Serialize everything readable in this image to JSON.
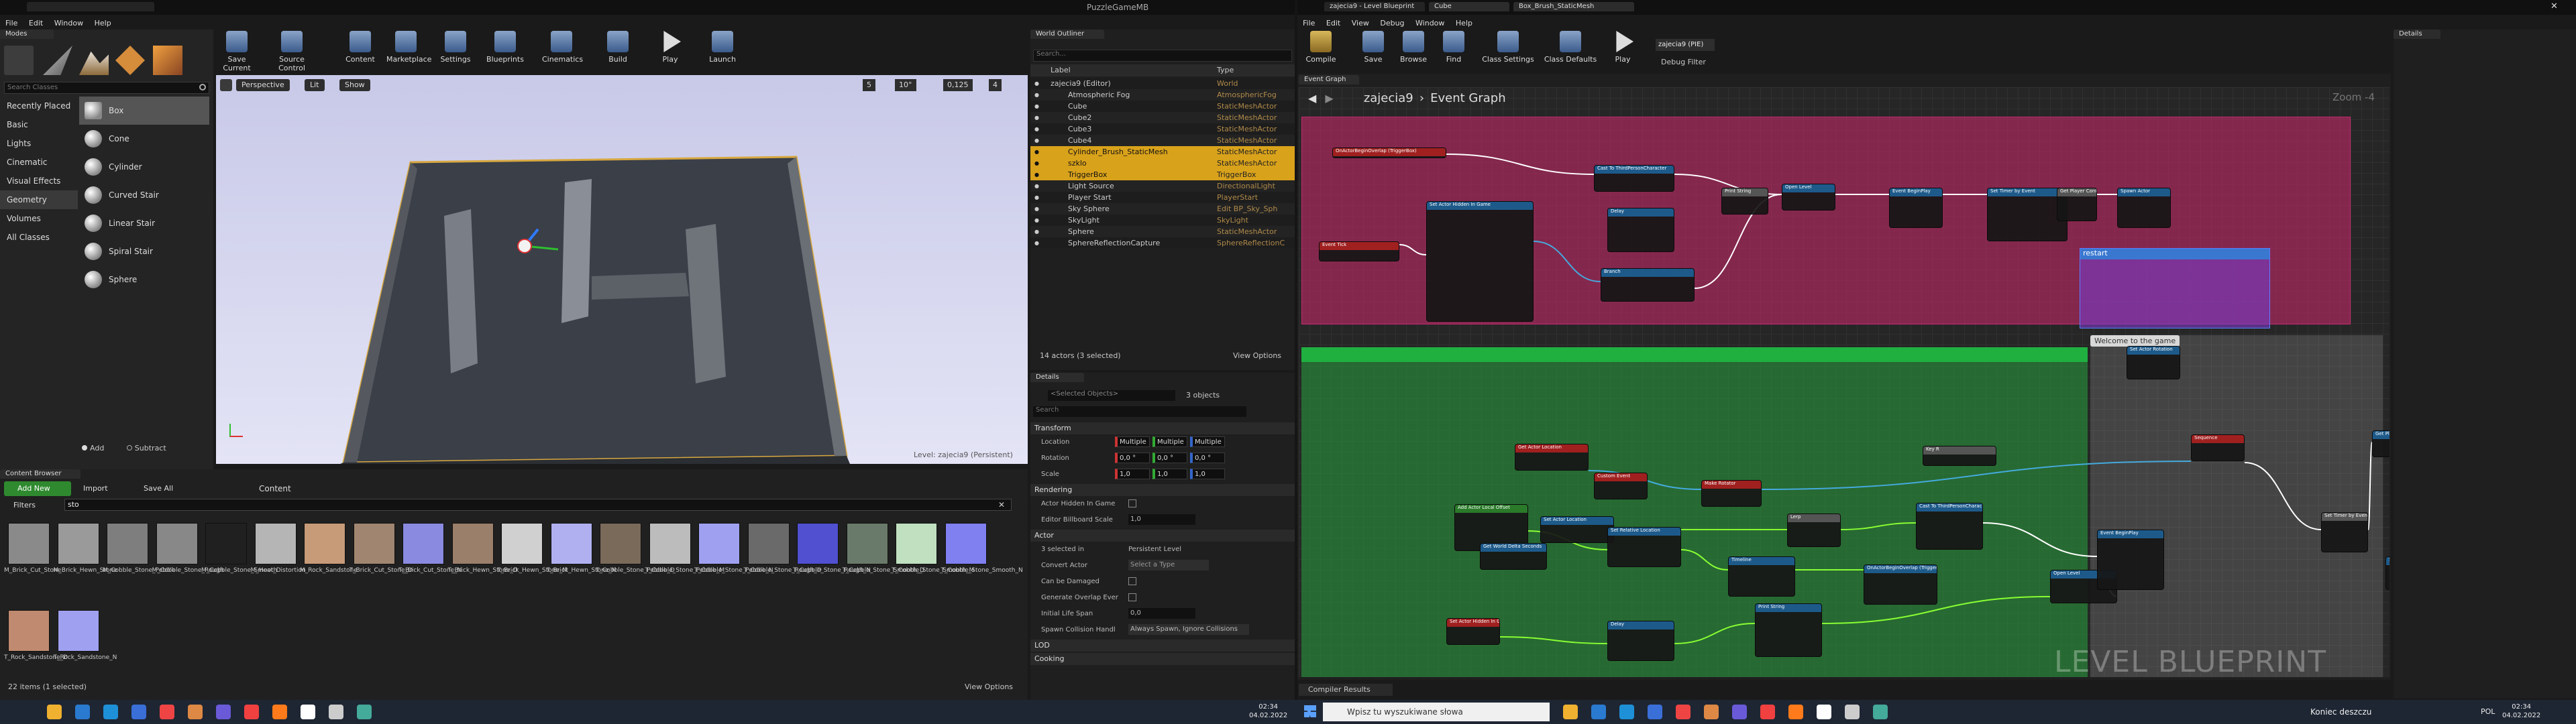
{
  "left_window": {
    "title": "PuzzleGameMB",
    "menu": [
      "File",
      "Edit",
      "Window",
      "Help"
    ],
    "modes_tab": "Modes",
    "toolbar": [
      "Save Current",
      "Source Control",
      "Content",
      "Marketplace",
      "Settings",
      "Blueprints",
      "Cinematics",
      "Build",
      "Play",
      "Launch"
    ],
    "search_classes_placeholder": "Search Classes",
    "place_categories": [
      "Recently Placed",
      "Basic",
      "Lights",
      "Cinematic",
      "Visual Effects",
      "Geometry",
      "Volumes",
      "All Classes"
    ],
    "place_items": [
      "Box",
      "Cone",
      "Cylinder",
      "Curved Stair",
      "Linear Stair",
      "Spiral Stair",
      "Sphere"
    ],
    "brush_add": "Add",
    "brush_subtract": "Subtract",
    "viewport": {
      "perspective": "Perspective",
      "lit": "Lit",
      "show": "Show",
      "grid_snap": "5",
      "rot_snap": "10°",
      "scale_snap": "0,125",
      "cam_speed": "4",
      "level_label": "Level:",
      "level_name": "zajecia9 (Persistent)"
    },
    "outliner": {
      "tab": "World Outliner",
      "search_placeholder": "Search...",
      "col_label": "Label",
      "col_type": "Type",
      "rows": [
        {
          "label": "zajecia9 (Editor)",
          "type": "World",
          "sel": false
        },
        {
          "label": "Atmospheric Fog",
          "type": "AtmosphericFog",
          "sel": false
        },
        {
          "label": "Cube",
          "type": "StaticMeshActor",
          "sel": false
        },
        {
          "label": "Cube2",
          "type": "StaticMeshActor",
          "sel": false
        },
        {
          "label": "Cube3",
          "type": "StaticMeshActor",
          "sel": false
        },
        {
          "label": "Cube4",
          "type": "StaticMeshActor",
          "sel": false
        },
        {
          "label": "Cylinder_Brush_StaticMesh",
          "type": "StaticMeshActor",
          "sel": true
        },
        {
          "label": "szklo",
          "type": "StaticMeshActor",
          "sel": true
        },
        {
          "label": "TriggerBox",
          "type": "TriggerBox",
          "sel": true
        },
        {
          "label": "Light Source",
          "type": "DirectionalLight",
          "sel": false
        },
        {
          "label": "Player Start",
          "type": "PlayerStart",
          "sel": false
        },
        {
          "label": "Sky Sphere",
          "type": "Edit BP_Sky_Sph",
          "sel": false
        },
        {
          "label": "SkyLight",
          "type": "SkyLight",
          "sel": false
        },
        {
          "label": "Sphere",
          "type": "StaticMeshActor",
          "sel": false
        },
        {
          "label": "SphereReflectionCapture",
          "type": "SphereReflectionC",
          "sel": false
        }
      ],
      "footer": "14 actors (3 selected)",
      "view_options": "View Options"
    },
    "details": {
      "tab": "Details",
      "selected": "<Selected Objects>",
      "count": "3 objects",
      "search_placeholder": "Search",
      "transform": "Transform",
      "location": "Location",
      "rotation": "Rotation",
      "scale": "Scale",
      "loc_vals": [
        "Multiple",
        "Multiple",
        "Multiple"
      ],
      "rot_vals": [
        "0,0 °",
        "0,0 °",
        "0,0 °"
      ],
      "scale_vals": [
        "1,0",
        "1,0",
        "1,0"
      ],
      "rendering": "Rendering",
      "actor_hidden": "Actor Hidden In Game",
      "billboard": "Editor Billboard Scale",
      "billboard_val": "1,0",
      "actor": "Actor",
      "sel_in": "3 selected in",
      "persistent": "Persistent Level",
      "convert": "Convert Actor",
      "convert_val": "Select a Type",
      "can_damage": "Can be Damaged",
      "overlap": "Generate Overlap Ever",
      "lifespan": "Initial Life Span",
      "lifespan_val": "0,0",
      "spawn": "Spawn Collision Handl",
      "spawn_val": "Always Spawn, Ignore Collisions",
      "lod": "LOD",
      "cooking": "Cooking"
    },
    "content_browser": {
      "tab": "Content Browser",
      "add_new": "Add New",
      "import": "Import",
      "save_all": "Save All",
      "path": "Content",
      "filters": "Filters",
      "search_value": "sto",
      "assets": [
        "M_Brick_Cut_Stone",
        "M_Brick_Hewn_Stone",
        "M_Cobble_Stone_Pebble",
        "M_Cobble_Stone_Rough",
        "M_Cobble_Stone_Smooth",
        "M_Heat_Distortion",
        "M_Rock_Sandstone",
        "T_Brick_Cut_Stone_D",
        "T_Brick_Cut_Stone_N",
        "T_Brick_Hewn_Stone_D",
        "T_Brick_Hewn_Stone_M",
        "T_Brick_Hewn_Stone_N",
        "T_Cobble_Stone_Pebble_D",
        "T_Cobble_Stone_Pebble_M",
        "T_Cobble_Stone_Pebble_N",
        "T_Cobble_Stone_Rough_D",
        "T_Cobble_Stone_Rough_N",
        "T_Cobble_Stone_Smooth_D",
        "T_Cobble_Stone_Smooth_M",
        "T_Cobble_Stone_Smooth_N",
        "T_Rock_Sandstone_D",
        "T_Rock_Sandstone_N"
      ],
      "footer": "22 items (1 selected)",
      "view_options": "View Options"
    }
  },
  "right_window": {
    "tabs": [
      "zajecia9 - Level Blueprint",
      "Cube",
      "Box_Brush_StaticMesh"
    ],
    "menu": [
      "File",
      "Edit",
      "View",
      "Debug",
      "Window",
      "Help"
    ],
    "toolbar": [
      "Compile",
      "Save",
      "Browse",
      "Find",
      "Class Settings",
      "Class Defaults",
      "Play"
    ],
    "debug_value": "zajecia9 (PIE)",
    "debug_filter": "Debug Filter",
    "graph_tab": "Event Graph",
    "breadcrumb_root": "zajecia9",
    "breadcrumb_graph": "Event Graph",
    "zoom": "Zoom -4",
    "comments": [
      "restart",
      "Welcome to the game"
    ],
    "nodes": [
      "OnActorBeginOverlap (TriggerBox)",
      "Cast To ThirdPersonCharacter",
      "Set Actor Hidden In Game",
      "Delay",
      "Print String",
      "Open Level",
      "Event BeginPlay",
      "Set Timer by Event",
      "Get Player Controller",
      "Spawn Actor",
      "Event Tick",
      "Branch",
      "Set Actor Rotation",
      "Make Rotator",
      "Get Actor Location",
      "Key R",
      "Custom Event",
      "Sequence",
      "Set Actor Location",
      "Add Actor Local Offset",
      "Set Relative Location",
      "Lerp",
      "Timeline",
      "Get World Delta Seconds"
    ],
    "watermark": "LEVEL BLUEPRINT",
    "details_tab": "Details",
    "compiler_tab": "Compiler Results"
  },
  "taskbar": {
    "left_time": "02:34",
    "left_date": "04.02.2022",
    "search_placeholder": "Wpisz tu wyszukiwane słowa",
    "notif": "Koniec deszczu",
    "lang": "POL",
    "right_time": "02:34",
    "right_date": "04.02.2022"
  }
}
